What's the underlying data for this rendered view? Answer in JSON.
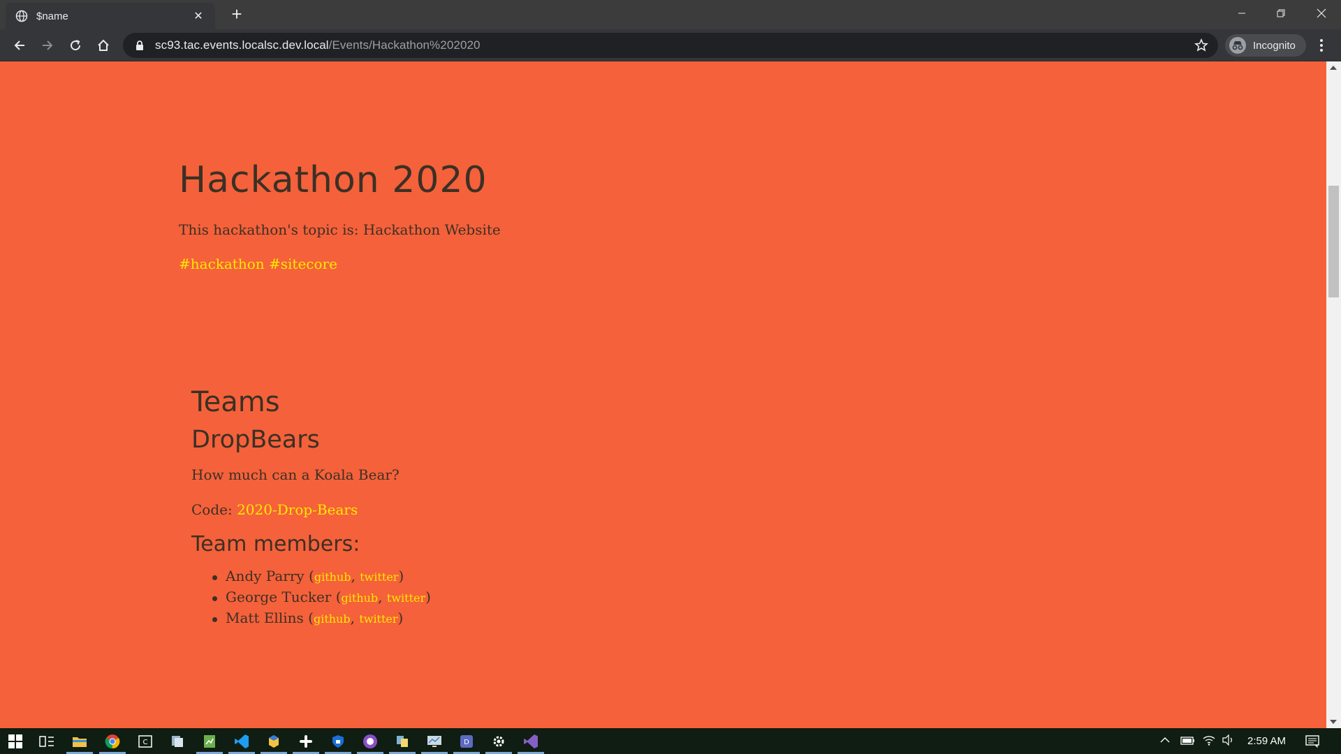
{
  "browser": {
    "tab_title": "$name",
    "url_host": "sc93.tac.events.localsc.dev.local",
    "url_path": "/Events/Hackathon%202020",
    "incognito_label": "Incognito"
  },
  "page": {
    "title": "Hackathon 2020",
    "topic": "This hackathon's topic is: Hackathon Website",
    "tags": [
      "#hackathon",
      "#sitecore"
    ],
    "teams_heading": "Teams",
    "team": {
      "name": "DropBears",
      "tagline": "How much can a Koala Bear?",
      "code_label": "Code: ",
      "code_value": "2020-Drop-Bears",
      "members_heading": "Team members:",
      "members": [
        {
          "name": "Andy Parry",
          "github": "github",
          "twitter": "twitter"
        },
        {
          "name": "George Tucker",
          "github": "github",
          "twitter": "twitter"
        },
        {
          "name": "Matt Ellins",
          "github": "github",
          "twitter": "twitter"
        }
      ]
    }
  },
  "colors": {
    "page_bg": "#f5613a",
    "link": "#ffe800",
    "text": "#3b3025"
  },
  "taskbar": {
    "clock": "2:59 AM",
    "apps": [
      "windows-start-icon",
      "task-view-icon",
      "file-explorer-icon",
      "chrome-icon",
      "app-icon",
      "app-icon",
      "app-icon",
      "vscode-icon",
      "app-icon",
      "slack-icon",
      "app-icon",
      "app-icon",
      "app-icon",
      "app-icon",
      "app-icon",
      "settings-icon",
      "visual-studio-icon"
    ]
  }
}
